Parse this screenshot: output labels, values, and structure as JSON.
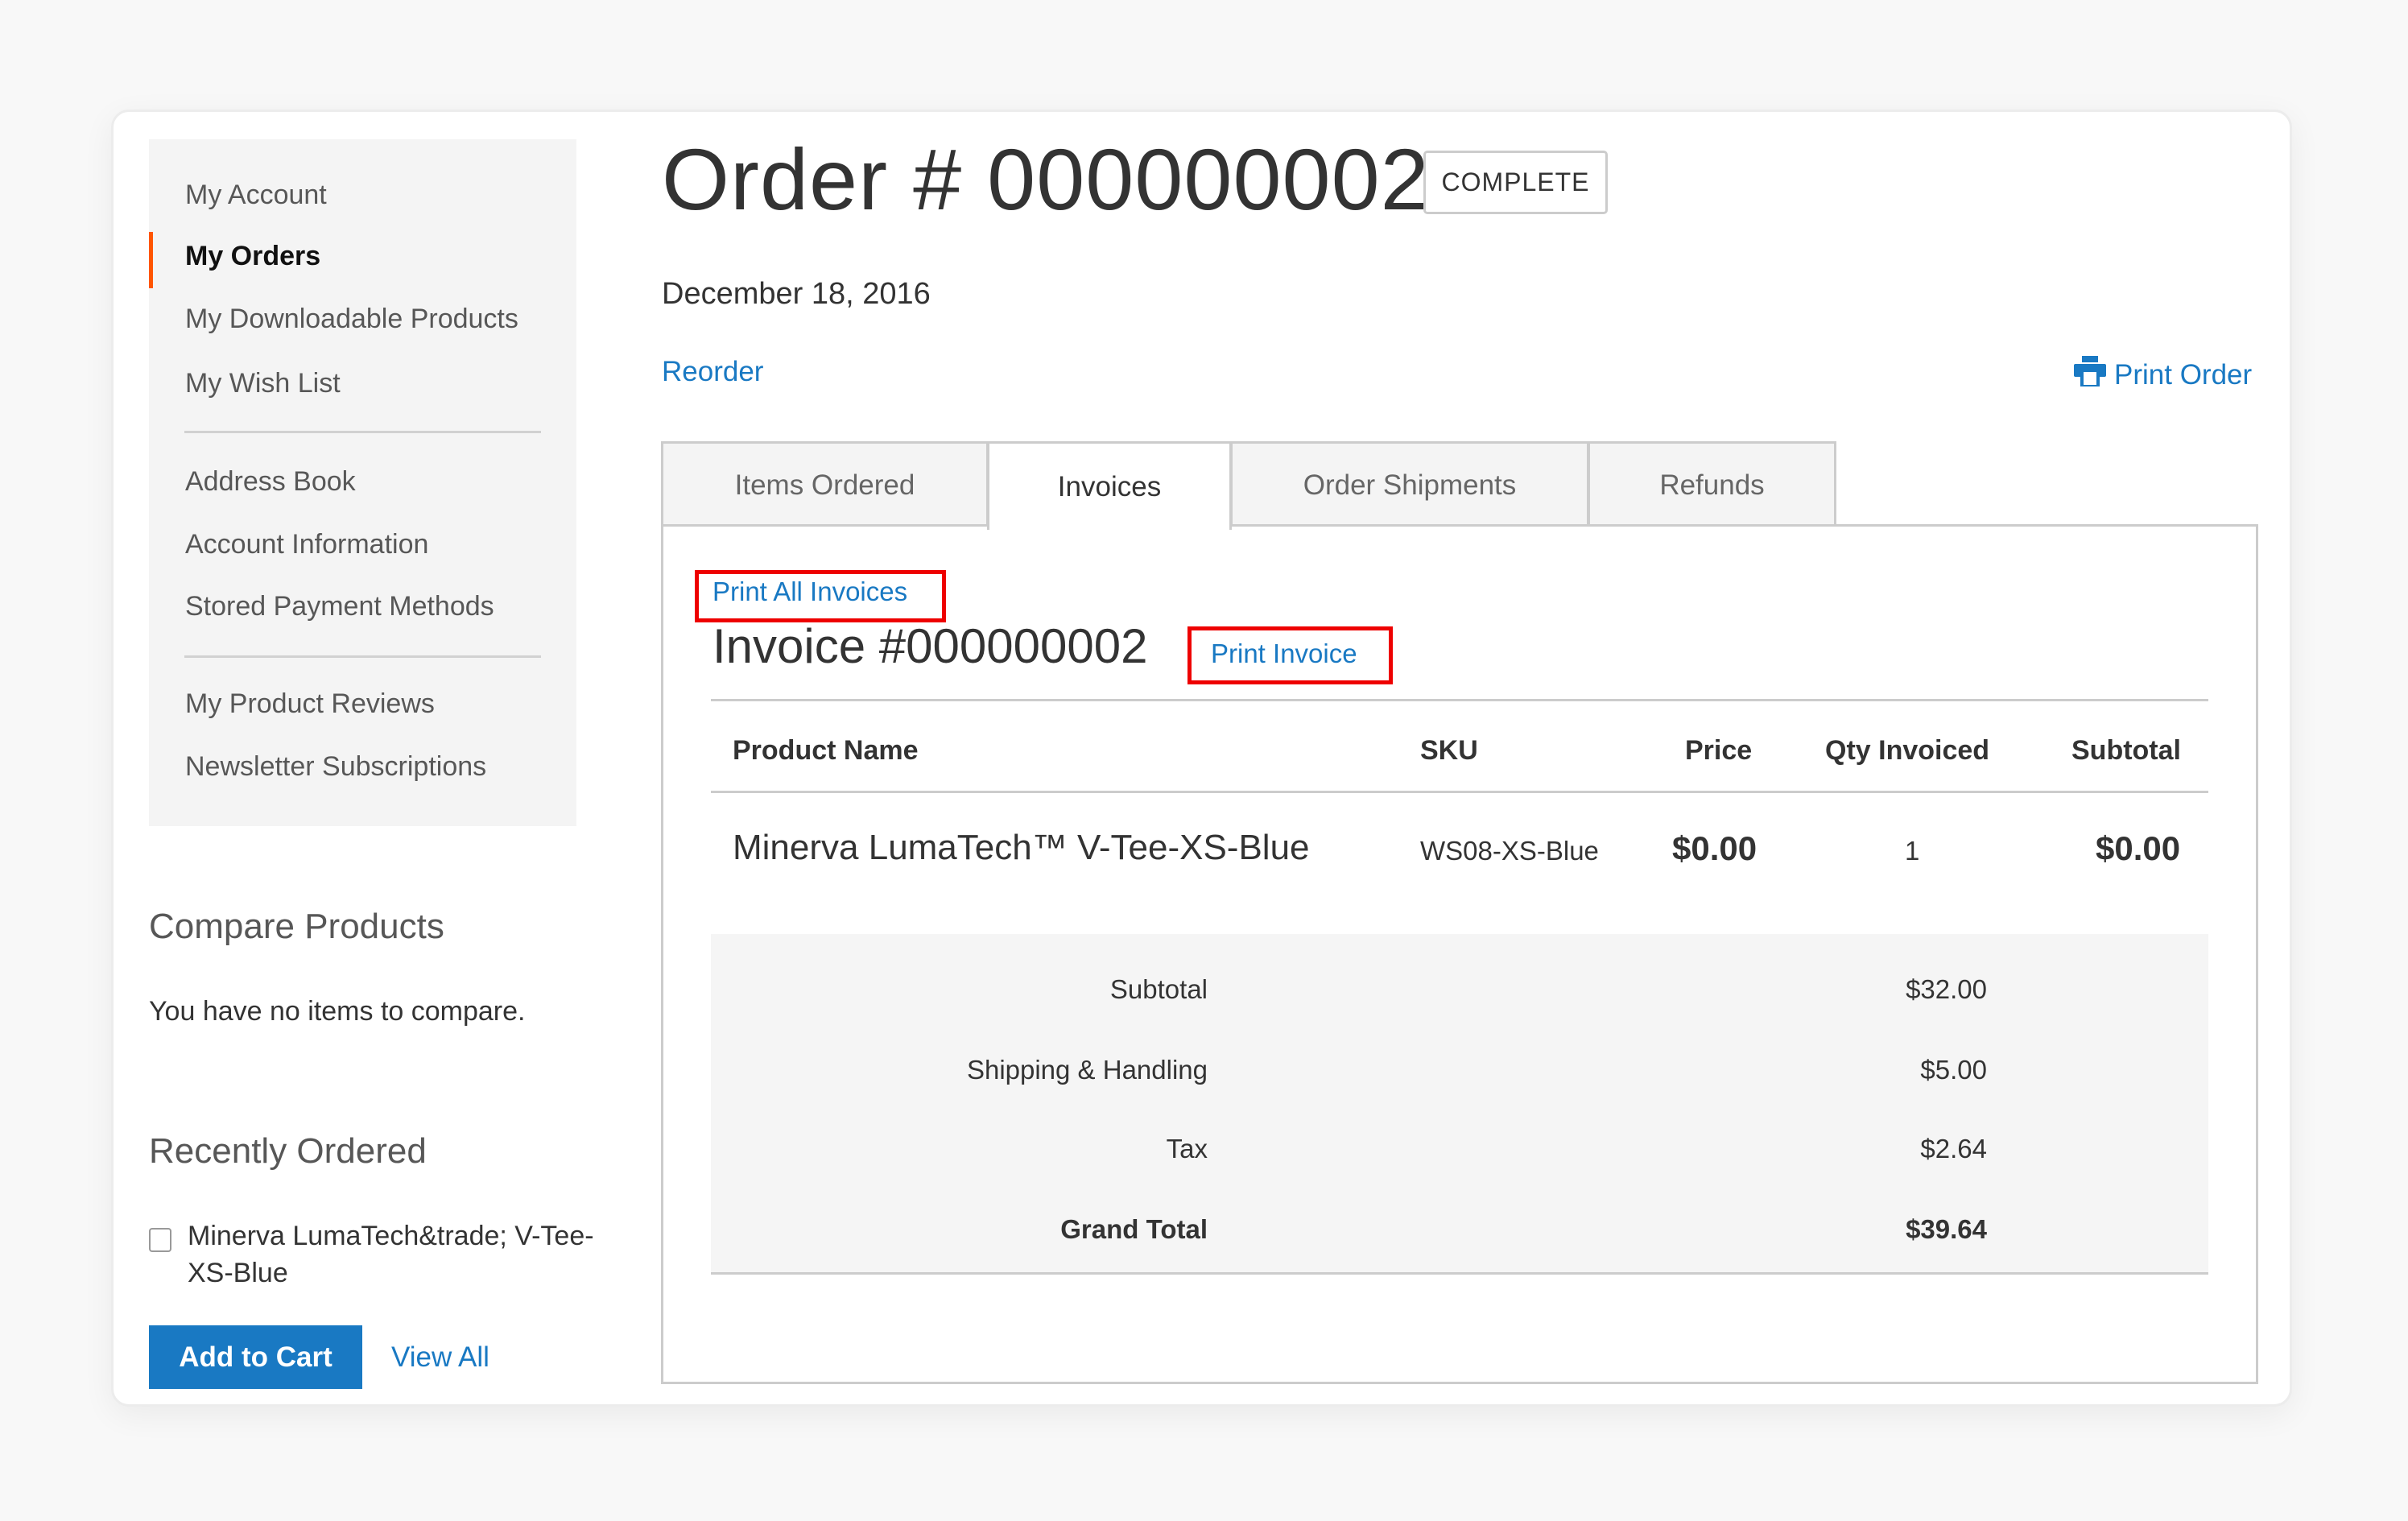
{
  "sidebar": {
    "nav_groups": [
      [
        {
          "label": "My Account",
          "active": false
        },
        {
          "label": "My Orders",
          "active": true
        },
        {
          "label": "My Downloadable Products",
          "active": false
        },
        {
          "label": "My Wish List",
          "active": false
        }
      ],
      [
        {
          "label": "Address Book",
          "active": false
        },
        {
          "label": "Account Information",
          "active": false
        },
        {
          "label": "Stored Payment Methods",
          "active": false
        }
      ],
      [
        {
          "label": "My Product Reviews",
          "active": false
        },
        {
          "label": "Newsletter Subscriptions",
          "active": false
        }
      ]
    ],
    "compare": {
      "title": "Compare Products",
      "empty_text": "You have no items to compare."
    },
    "recently_ordered": {
      "title": "Recently Ordered",
      "items": [
        {
          "name_line1": "Minerva LumaTech&trade; V-Tee-",
          "name_line2": "XS-Blue",
          "checked": false
        }
      ],
      "add_to_cart_label": "Add to Cart",
      "view_all_label": "View All"
    }
  },
  "order": {
    "title": "Order # 000000002",
    "status": "COMPLETE",
    "date": "December 18, 2016",
    "reorder_label": "Reorder",
    "print_order_label": "Print Order",
    "print_icon": "printer-icon"
  },
  "tabs": [
    {
      "label": "Items Ordered",
      "active": false
    },
    {
      "label": "Invoices",
      "active": true
    },
    {
      "label": "Order Shipments",
      "active": false
    },
    {
      "label": "Refunds",
      "active": false
    }
  ],
  "invoices": {
    "print_all_label": "Print All Invoices",
    "invoice_title": "Invoice #000000002",
    "print_invoice_label": "Print Invoice",
    "columns": [
      "Product Name",
      "SKU",
      "Price",
      "Qty Invoiced",
      "Subtotal"
    ],
    "rows": [
      {
        "product_name": "Minerva LumaTech™ V-Tee-XS-Blue",
        "sku": "WS08-XS-Blue",
        "price": "$0.00",
        "qty": "1",
        "subtotal": "$0.00"
      }
    ],
    "totals": [
      {
        "label": "Subtotal",
        "value": "$32.00",
        "bold": false
      },
      {
        "label": "Shipping & Handling",
        "value": "$5.00",
        "bold": false
      },
      {
        "label": "Tax",
        "value": "$2.64",
        "bold": false
      },
      {
        "label": "Grand Total",
        "value": "$39.64",
        "bold": true
      }
    ]
  },
  "colors": {
    "accent_link": "#1979c3",
    "active_nav_marker": "#ff5501",
    "highlight_box": "#e00000"
  }
}
